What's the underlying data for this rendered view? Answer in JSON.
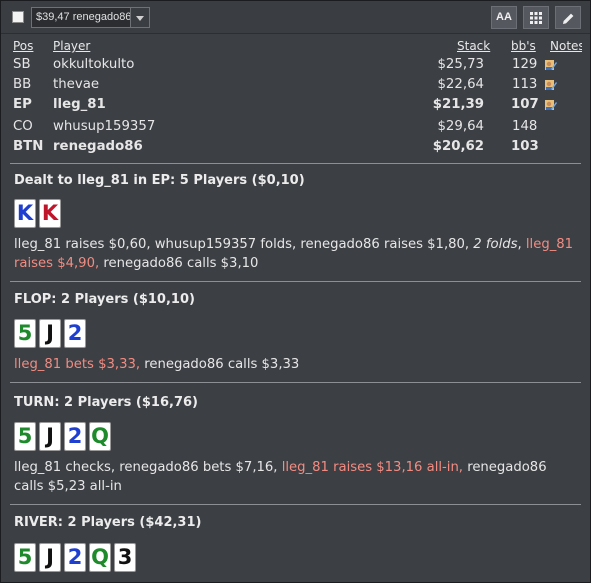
{
  "toolbar": {
    "select_value": "$39,47 renegado86",
    "font_button": "AA"
  },
  "headers": {
    "pos": "Pos",
    "player": "Player",
    "stack": "Stack",
    "bbs": "bb's",
    "notes": "Notes"
  },
  "players": [
    {
      "pos": "SB",
      "name": "okkultokulto",
      "stack": "$25,73",
      "bbs": "129",
      "note": true,
      "bold": false
    },
    {
      "pos": "BB",
      "name": "thevae",
      "stack": "$22,64",
      "bbs": "113",
      "note": true,
      "bold": false
    },
    {
      "pos": "EP",
      "name": "lleg_81",
      "stack": "$21,39",
      "bbs": "107",
      "note": true,
      "bold": true
    },
    {
      "pos": "CO",
      "name": "whusup159357",
      "stack": "$29,64",
      "bbs": "148",
      "note": false,
      "bold": false
    },
    {
      "pos": "BTN",
      "name": "renegado86",
      "stack": "$20,62",
      "bbs": "103",
      "note": false,
      "bold": true
    }
  ],
  "preflop": {
    "title": "Dealt to lleg_81 in EP: 5 Players ($0,10)",
    "cards": [
      {
        "rank": "K",
        "color": "#1f3fd1"
      },
      {
        "rank": "K",
        "color": "#c0162b"
      }
    ],
    "text_a": "lleg_81 raises $0,60, whusup159357 folds, renegado86 raises $1,80, ",
    "text_italic": "2 folds",
    "text_b": ", ",
    "text_hl": "lleg_81 raises $4,90,",
    "text_c": " renegado86 calls $3,10"
  },
  "flop": {
    "title": "FLOP: 2 Players ($10,10)",
    "cards": [
      {
        "rank": "5",
        "color": "#1e8a2c"
      },
      {
        "rank": "J",
        "color": "#111111"
      },
      {
        "rank": "2",
        "color": "#1f3fd1"
      }
    ],
    "text_hl": "lleg_81 bets $3,33,",
    "text_c": " renegado86 calls $3,33"
  },
  "turn": {
    "title": "TURN: 2 Players ($16,76)",
    "cards": [
      {
        "rank": "5",
        "color": "#1e8a2c"
      },
      {
        "rank": "J",
        "color": "#111111"
      },
      {
        "rank": "2",
        "color": "#1f3fd1"
      },
      {
        "rank": "Q",
        "color": "#1e8a2c"
      }
    ],
    "text_a": "lleg_81 checks, renegado86 bets $7,16, ",
    "text_hl": "lleg_81 raises $13,16 all-in,",
    "text_c": " renegado86 calls $5,23 all-in"
  },
  "river": {
    "title": "RIVER: 2 Players ($42,31)",
    "cards": [
      {
        "rank": "5",
        "color": "#1e8a2c"
      },
      {
        "rank": "J",
        "color": "#111111"
      },
      {
        "rank": "2",
        "color": "#1f3fd1"
      },
      {
        "rank": "Q",
        "color": "#1e8a2c"
      },
      {
        "rank": "3",
        "color": "#111111"
      }
    ]
  }
}
